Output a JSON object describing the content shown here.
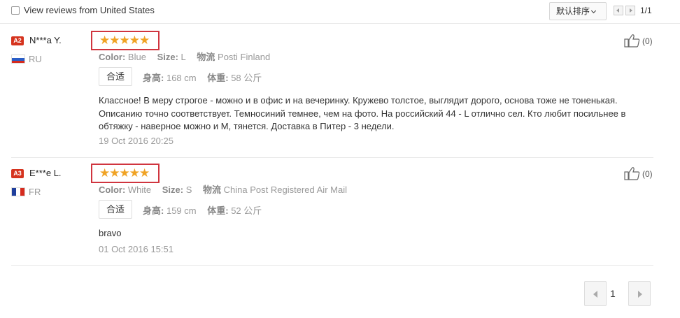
{
  "filter": {
    "checked": false,
    "label": "View reviews from United States"
  },
  "sort": {
    "label": "默认排序"
  },
  "mini_pager": {
    "text": "1/1"
  },
  "reviews": [
    {
      "badge": "A2",
      "name": "N***a Y.",
      "country": "RU",
      "stars": 5,
      "stars_text": "★★★★★",
      "color_label": "Color:",
      "color_value": "Blue",
      "size_label": "Size:",
      "size_value": "L",
      "shipping_label": "物流",
      "shipping_value": "Posti Finland",
      "fit": "合适",
      "height_label": "身高:",
      "height_value": "168 cm",
      "weight_label": "体重:",
      "weight_value": "58 公斤",
      "text": "Классное! В меру строгое - можно и в офис и на вечеринку. Кружево толстое, выглядит дорого, основа тоже не тоненькая. Описанию точно соответствует. Темносиний темнее, чем на фото. На российский 44 - L отлично сел. Кто любит посильнее в обтяжку - наверное можно и M, тянется. Доставка в Питер - 3 недели.",
      "date": "19 Oct 2016 20:25",
      "likes": "(0)"
    },
    {
      "badge": "A3",
      "name": "E***e L.",
      "country": "FR",
      "stars": 5,
      "stars_text": "★★★★★",
      "color_label": "Color:",
      "color_value": "White",
      "size_label": "Size:",
      "size_value": "S",
      "shipping_label": "物流",
      "shipping_value": "China Post Registered Air Mail",
      "fit": "合适",
      "height_label": "身高:",
      "height_value": "159 cm",
      "weight_label": "体重:",
      "weight_value": "52 公斤",
      "text": "bravo",
      "date": "01 Oct 2016 15:51",
      "likes": "(0)"
    }
  ],
  "pager": {
    "current": "1"
  },
  "colors": {
    "badge": "#d5331e",
    "star": "#f0a324",
    "highlight_box": "#d0353f"
  }
}
